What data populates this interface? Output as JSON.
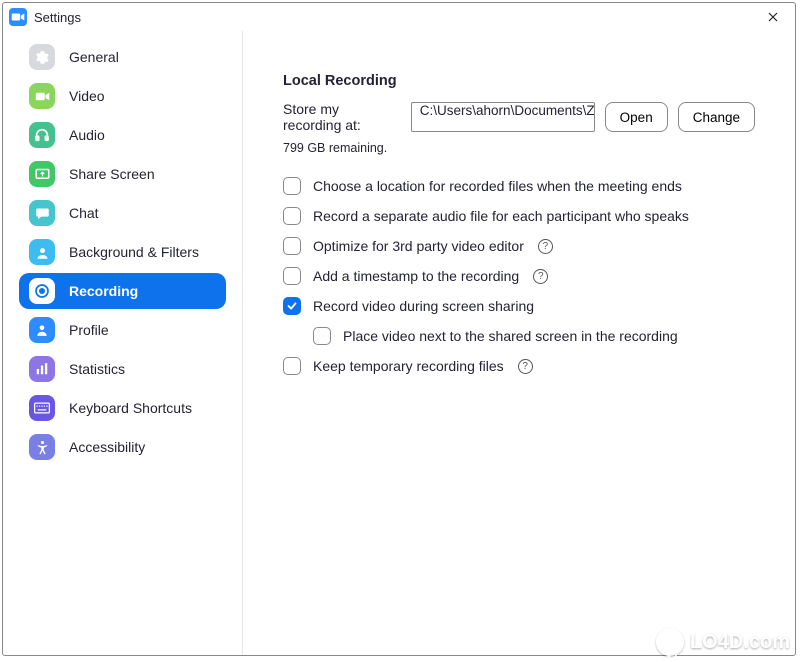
{
  "window": {
    "title": "Settings"
  },
  "sidebar": {
    "items": [
      {
        "label": "General"
      },
      {
        "label": "Video"
      },
      {
        "label": "Audio"
      },
      {
        "label": "Share Screen"
      },
      {
        "label": "Chat"
      },
      {
        "label": "Background & Filters"
      },
      {
        "label": "Recording"
      },
      {
        "label": "Profile"
      },
      {
        "label": "Statistics"
      },
      {
        "label": "Keyboard Shortcuts"
      },
      {
        "label": "Accessibility"
      }
    ]
  },
  "main": {
    "section_title": "Local Recording",
    "store_label": "Store my recording at:",
    "path_value": "C:\\Users\\ahorn\\Documents\\Zoom",
    "open_label": "Open",
    "change_label": "Change",
    "remaining": "799 GB remaining.",
    "options": [
      {
        "label": "Choose a location for recorded files when the meeting ends",
        "checked": false,
        "help": false
      },
      {
        "label": "Record a separate audio file for each participant who speaks",
        "checked": false,
        "help": false
      },
      {
        "label": "Optimize for 3rd party video editor",
        "checked": false,
        "help": true
      },
      {
        "label": "Add a timestamp to the recording",
        "checked": false,
        "help": true
      },
      {
        "label": "Record video during screen sharing",
        "checked": true,
        "help": false
      },
      {
        "label": "Place video next to the shared screen in the recording",
        "checked": false,
        "help": false,
        "indent": true
      },
      {
        "label": "Keep temporary recording files",
        "checked": false,
        "help": true
      }
    ]
  },
  "watermark": {
    "text": "LO4D.com"
  }
}
